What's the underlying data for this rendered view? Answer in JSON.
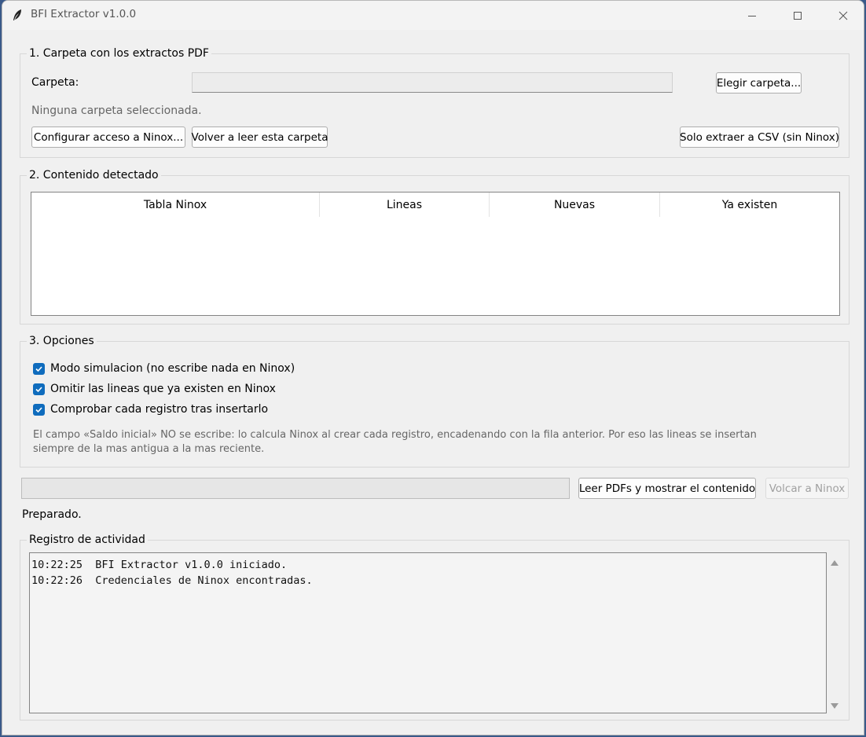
{
  "window": {
    "title": "BFI Extractor v1.0.0",
    "icons": {
      "app": "feather-icon",
      "minimize": "minimize-icon",
      "maximize": "maximize-icon",
      "close": "close-icon"
    }
  },
  "section1": {
    "legend": "1. Carpeta con los extractos PDF",
    "folder_label": "Carpeta:",
    "folder_value": "",
    "choose_button": "Elegir carpeta...",
    "status": "Ninguna carpeta seleccionada.",
    "configure_button": "Configurar acceso a Ninox...",
    "reread_button": "Volver a leer esta carpeta",
    "csv_button": "Solo extraer a CSV (sin Ninox)"
  },
  "section2": {
    "legend": "2. Contenido detectado",
    "columns": [
      "Tabla Ninox",
      "Lineas",
      "Nuevas",
      "Ya existen"
    ],
    "rows": []
  },
  "section3": {
    "legend": "3. Opciones",
    "options": [
      {
        "label": "Modo simulacion (no escribe nada en Ninox)",
        "checked": true
      },
      {
        "label": "Omitir las lineas que ya existen en Ninox",
        "checked": true
      },
      {
        "label": "Comprobar cada registro tras insertarlo",
        "checked": true
      }
    ],
    "note_line1": "El campo «Saldo inicial» NO se escribe: lo calcula Ninox al crear cada registro, encadenando con la fila anterior. Por eso las lineas se insertan",
    "note_line2": "siempre de la mas antigua a la mas reciente."
  },
  "actions": {
    "progress": 0,
    "read_button": "Leer PDFs y mostrar el contenido",
    "dump_button": "Volcar a Ninox",
    "status": "Preparado."
  },
  "log": {
    "legend": "Registro de actividad",
    "lines": [
      "10:22:25  BFI Extractor v1.0.0 iniciado.",
      "10:22:26  Credenciales de Ninox encontradas."
    ]
  },
  "colors": {
    "accent": "#0f6cbd",
    "window_bg": "#f0f0f0"
  }
}
